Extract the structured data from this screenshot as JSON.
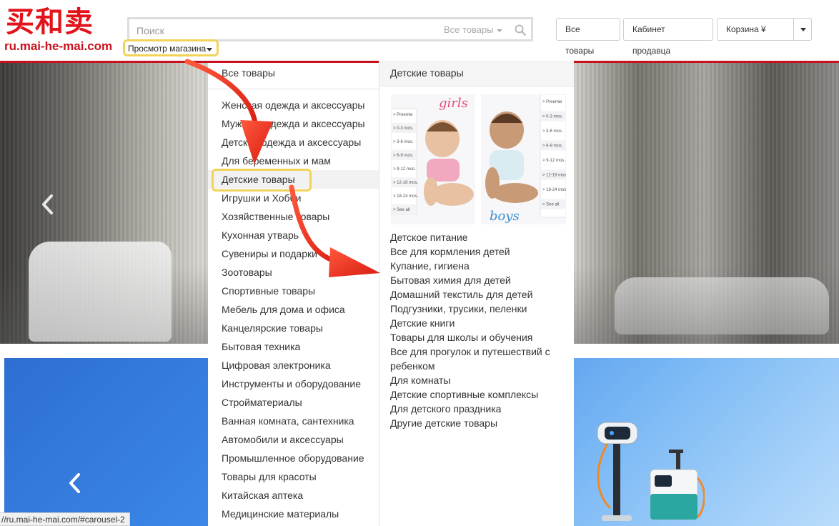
{
  "logo": {
    "cn": "买和卖",
    "url": "ru.mai-he-mai.com"
  },
  "search": {
    "placeholder": "Поиск",
    "category": "Все товары"
  },
  "browse_store": "Просмотр магазина",
  "header_buttons": {
    "all_products": "Все товары",
    "seller_cabinet": "Кабинет продавца",
    "cart": "Корзина ¥"
  },
  "menu": {
    "all_label": "Все товары",
    "active_index": 4,
    "items": [
      "Женская одежда и аксессуары",
      "Мужская одежда и аксессуары",
      "Детская одежда и аксессуары",
      "Для беременных и мам",
      "Детские товары",
      "Игрушки и Хобби",
      "Хозяйственные товары",
      "Кухонная утварь",
      "Сувениры и подарки",
      "Зоотовары",
      "Спортивные товары",
      "Мебель для дома и офиса",
      "Канцелярские товары",
      "Бытовая техника",
      "Цифровая электроника",
      "Инструменты и оборудование",
      "Стройматериалы",
      "Ванная комната, сантехника",
      "Автомобили и аксессуары",
      "Промышленное оборудование",
      "Товары для красоты",
      "Китайская аптека",
      "Медицинские материалы"
    ]
  },
  "submenu": {
    "title": "Детские товары",
    "image_labels": {
      "girls": "girls",
      "boys": "boys",
      "sizes": [
        "> Preemie",
        "> 0-3 mos.",
        "> 3-6 mos.",
        "> 6-9 mos.",
        "> 9-12 mos.",
        "> 12-18 mos.",
        "> 18-24 mos.",
        "> See all"
      ]
    },
    "items": [
      "Детское питание",
      "Все для кормления детей",
      "Купание, гигиена",
      "Бытовая химия для детей",
      "Домашний текстиль для детей",
      "Подгузники, трусики, пеленки",
      "Детские книги",
      "Товары для школы и обучения",
      "Все для прогулок и путешествий с ребенком",
      "Для комнаты",
      "Детские спортивные комплексы",
      "Для детского праздника",
      "Другие детские товары"
    ]
  },
  "status_bar": "//ru.mai-he-mai.com/#carousel-2",
  "colors": {
    "brand_red": "#e3131b",
    "highlight_yellow": "#f2d35a",
    "arrow_red": "#e8291c"
  }
}
